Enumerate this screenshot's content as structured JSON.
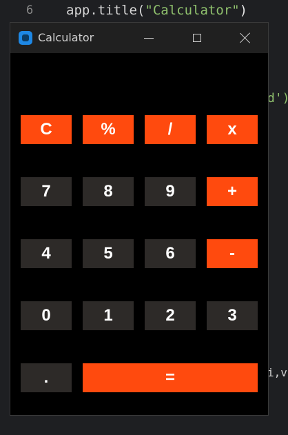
{
  "editor": {
    "line_number": "6",
    "code_prefix": "app.title(",
    "code_string": "\"Calculator\"",
    "code_suffix": ")",
    "fragment_right_1": "d')",
    "fragment_right_2": "i,v"
  },
  "window": {
    "title": "Calculator",
    "controls": {
      "minimize": "minimize-icon",
      "maximize": "maximize-icon",
      "close": "close-icon"
    }
  },
  "keypad": {
    "rows": [
      [
        {
          "label": "C",
          "kind": "op"
        },
        {
          "label": "%",
          "kind": "op"
        },
        {
          "label": "/",
          "kind": "op"
        },
        {
          "label": "x",
          "kind": "op"
        }
      ],
      [
        {
          "label": "7",
          "kind": "num"
        },
        {
          "label": "8",
          "kind": "num"
        },
        {
          "label": "9",
          "kind": "num"
        },
        {
          "label": "+",
          "kind": "op"
        }
      ],
      [
        {
          "label": "4",
          "kind": "num"
        },
        {
          "label": "5",
          "kind": "num"
        },
        {
          "label": "6",
          "kind": "num"
        },
        {
          "label": "-",
          "kind": "op"
        }
      ],
      [
        {
          "label": "0",
          "kind": "num"
        },
        {
          "label": "1",
          "kind": "num"
        },
        {
          "label": "2",
          "kind": "num"
        },
        {
          "label": "3",
          "kind": "num"
        }
      ],
      [
        {
          "label": ".",
          "kind": "num"
        },
        {
          "label": "=",
          "kind": "op"
        }
      ]
    ]
  },
  "colors": {
    "operator_key": "#ff4a0e",
    "number_key": "#2d2a28",
    "display_background": "#000000",
    "titlebar": "#202020"
  }
}
